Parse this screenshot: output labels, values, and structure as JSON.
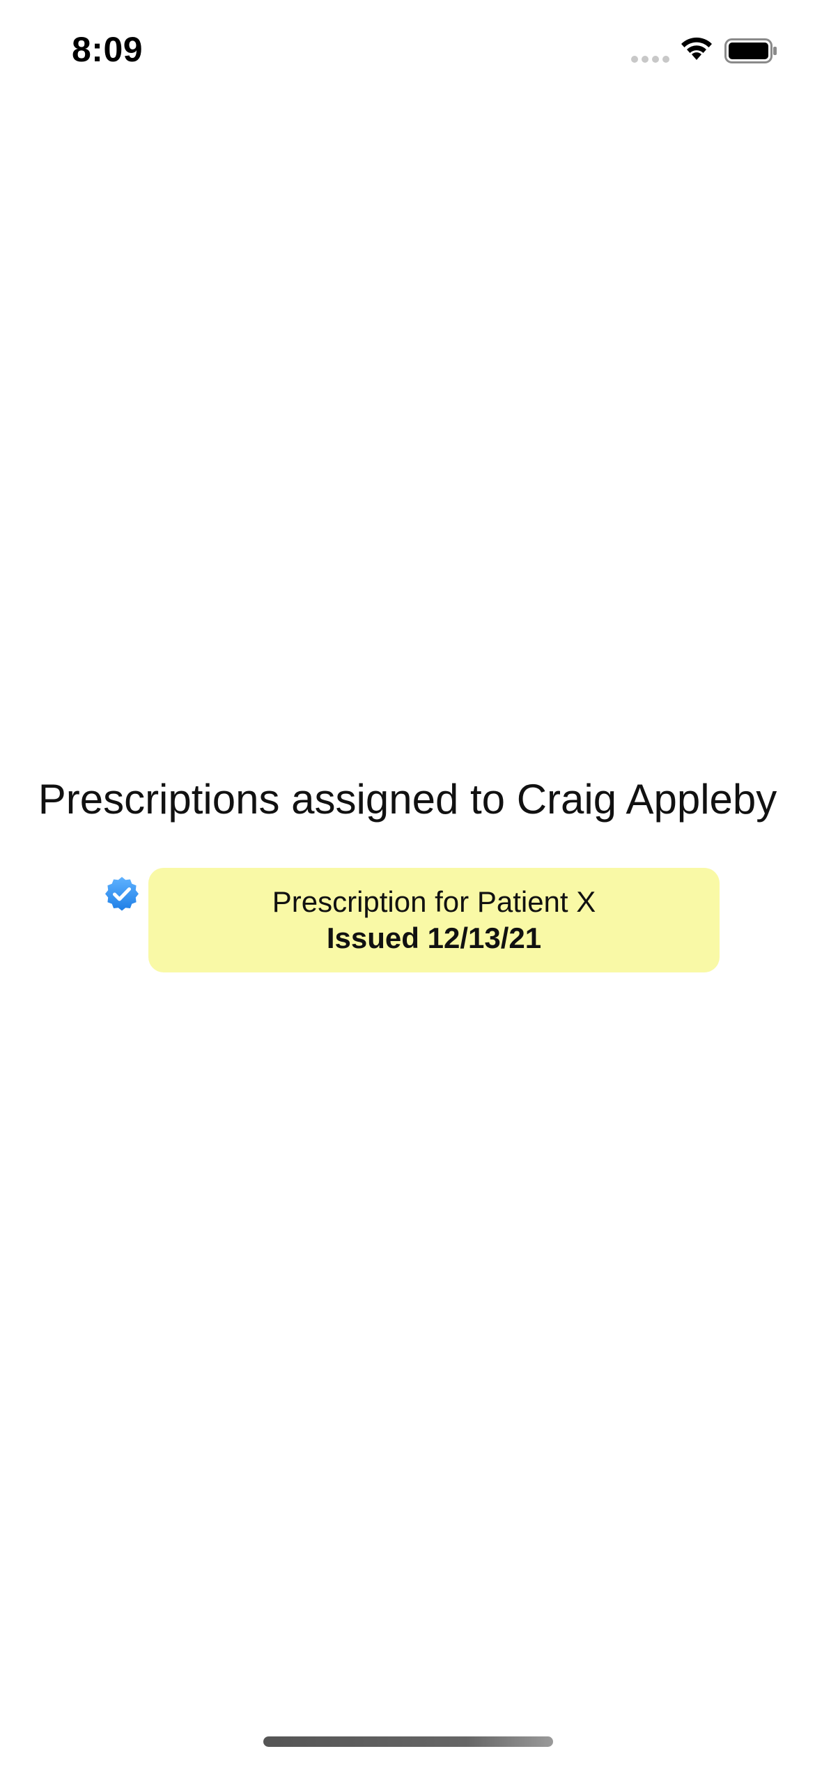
{
  "status_bar": {
    "time": "8:09",
    "signal_icon": "cellular-signal-icon",
    "wifi_icon": "wifi-icon",
    "battery_icon": "battery-icon"
  },
  "main": {
    "title": "Prescriptions assigned to Craig Appleby",
    "prescriptions": [
      {
        "status_icon": "verified-badge-icon",
        "title": "Prescription for Patient X",
        "subtitle": "Issued 12/13/21"
      }
    ]
  },
  "colors": {
    "card_background": "#f9f9a6",
    "verified_badge": "#2f8ef0"
  }
}
